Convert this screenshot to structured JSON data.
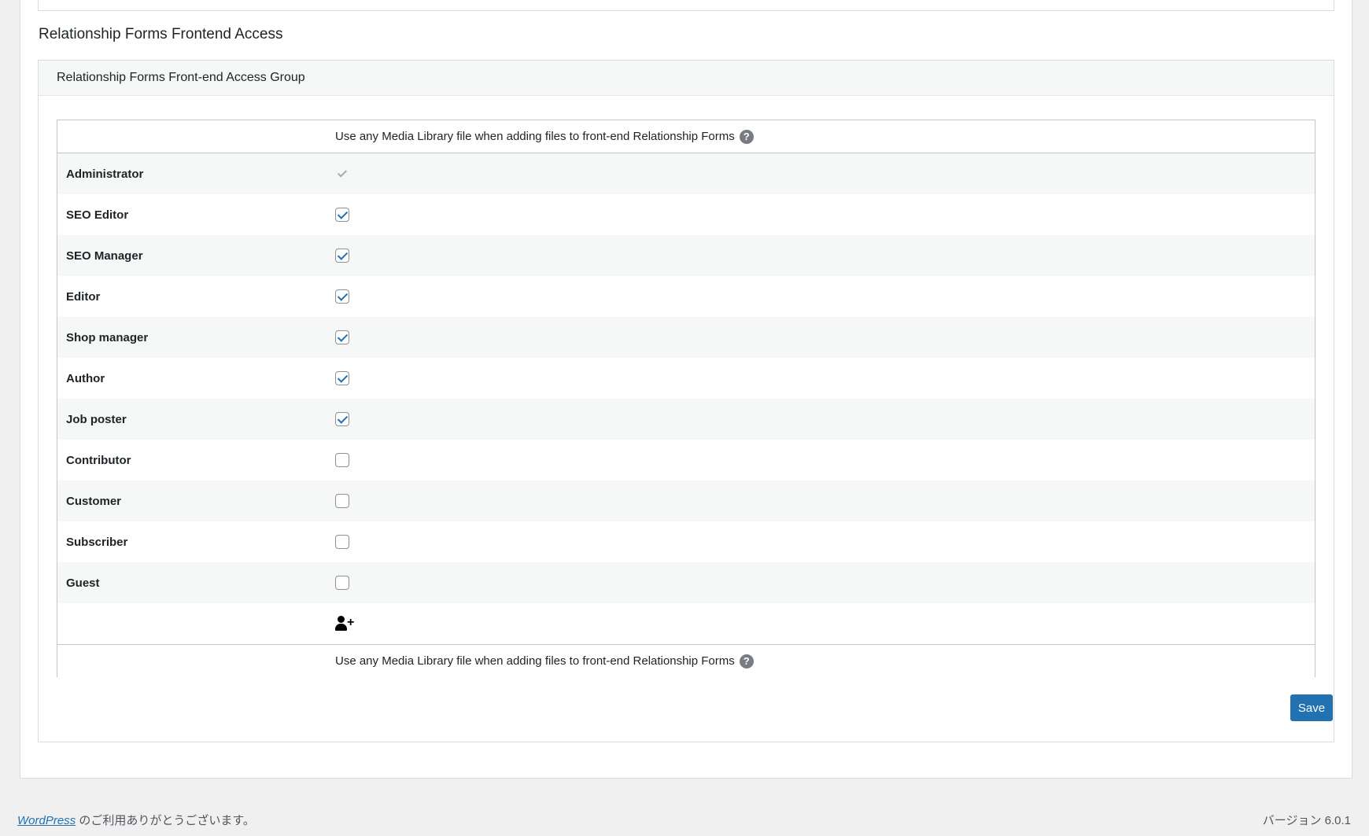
{
  "section": {
    "title": "Relationship Forms Frontend Access"
  },
  "postbox": {
    "header": "Relationship Forms Front-end Access Group"
  },
  "table": {
    "column_header": "Use any Media Library file when adding files to front-end Relationship Forms",
    "help_glyph": "?",
    "rows": [
      {
        "role": "Administrator",
        "checked": true,
        "disabled": true
      },
      {
        "role": "SEO Editor",
        "checked": true,
        "disabled": false
      },
      {
        "role": "SEO Manager",
        "checked": true,
        "disabled": false
      },
      {
        "role": "Editor",
        "checked": true,
        "disabled": false
      },
      {
        "role": "Shop manager",
        "checked": true,
        "disabled": false
      },
      {
        "role": "Author",
        "checked": true,
        "disabled": false
      },
      {
        "role": "Job poster",
        "checked": true,
        "disabled": false
      },
      {
        "role": "Contributor",
        "checked": false,
        "disabled": false
      },
      {
        "role": "Customer",
        "checked": false,
        "disabled": false
      },
      {
        "role": "Subscriber",
        "checked": false,
        "disabled": false
      },
      {
        "role": "Guest",
        "checked": false,
        "disabled": false
      }
    ],
    "add_icon": "user-plus-icon",
    "footer_header": "Use any Media Library file when adding files to front-end Relationship Forms"
  },
  "actions": {
    "save_label": "Save"
  },
  "footer": {
    "wordpress_link": "WordPress",
    "thanks_text": " のご利用ありがとうございます。",
    "version": "バージョン 6.0.1"
  },
  "colors": {
    "accent": "#2271b1",
    "background": "#f0f0f1",
    "row_alt": "#f6f7f7"
  }
}
